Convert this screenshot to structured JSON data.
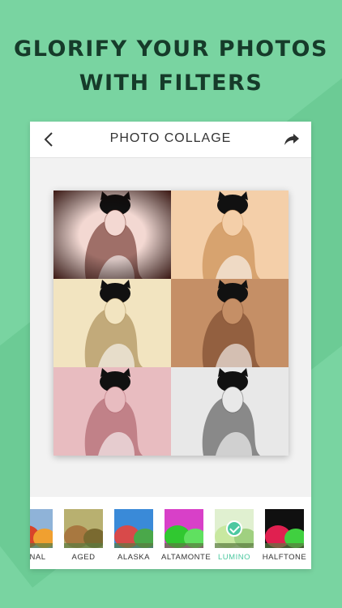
{
  "headline": {
    "line1": "GLORIFY YOUR PHOTOS",
    "line2": "WITH FILTERS"
  },
  "navbar": {
    "title": "PHOTO COLLAGE",
    "back_icon": "chevron-left-icon",
    "share_icon": "share-arrow-icon"
  },
  "collage": {
    "cells": [
      {
        "filter": "vignette-dark",
        "bg": "#f3d8d2",
        "tint": "#5a1a10"
      },
      {
        "filter": "peach",
        "bg": "#f4cfa9",
        "tint": "#c08040"
      },
      {
        "filter": "cream",
        "bg": "#f2e4c0",
        "tint": "#9a7a40"
      },
      {
        "filter": "brown",
        "bg": "#c58f66",
        "tint": "#6a3a20"
      },
      {
        "filter": "pink",
        "bg": "#e8bcc0",
        "tint": "#a0505a"
      },
      {
        "filter": "mono",
        "bg": "#e8e8e8",
        "tint": "#3a3a3a"
      }
    ]
  },
  "filters": {
    "items": [
      {
        "label": "GINAL",
        "selected": false
      },
      {
        "label": "AGED",
        "selected": false
      },
      {
        "label": "ALASKA",
        "selected": false
      },
      {
        "label": "ALTAMONTE",
        "selected": false
      },
      {
        "label": "LUMINO",
        "selected": true
      },
      {
        "label": "HALFTONE",
        "selected": false
      }
    ],
    "selected_color": "#4cc8a0"
  },
  "colors": {
    "background": "#79d4a1",
    "headline": "#163b2a",
    "accent": "#4cc8a0"
  }
}
